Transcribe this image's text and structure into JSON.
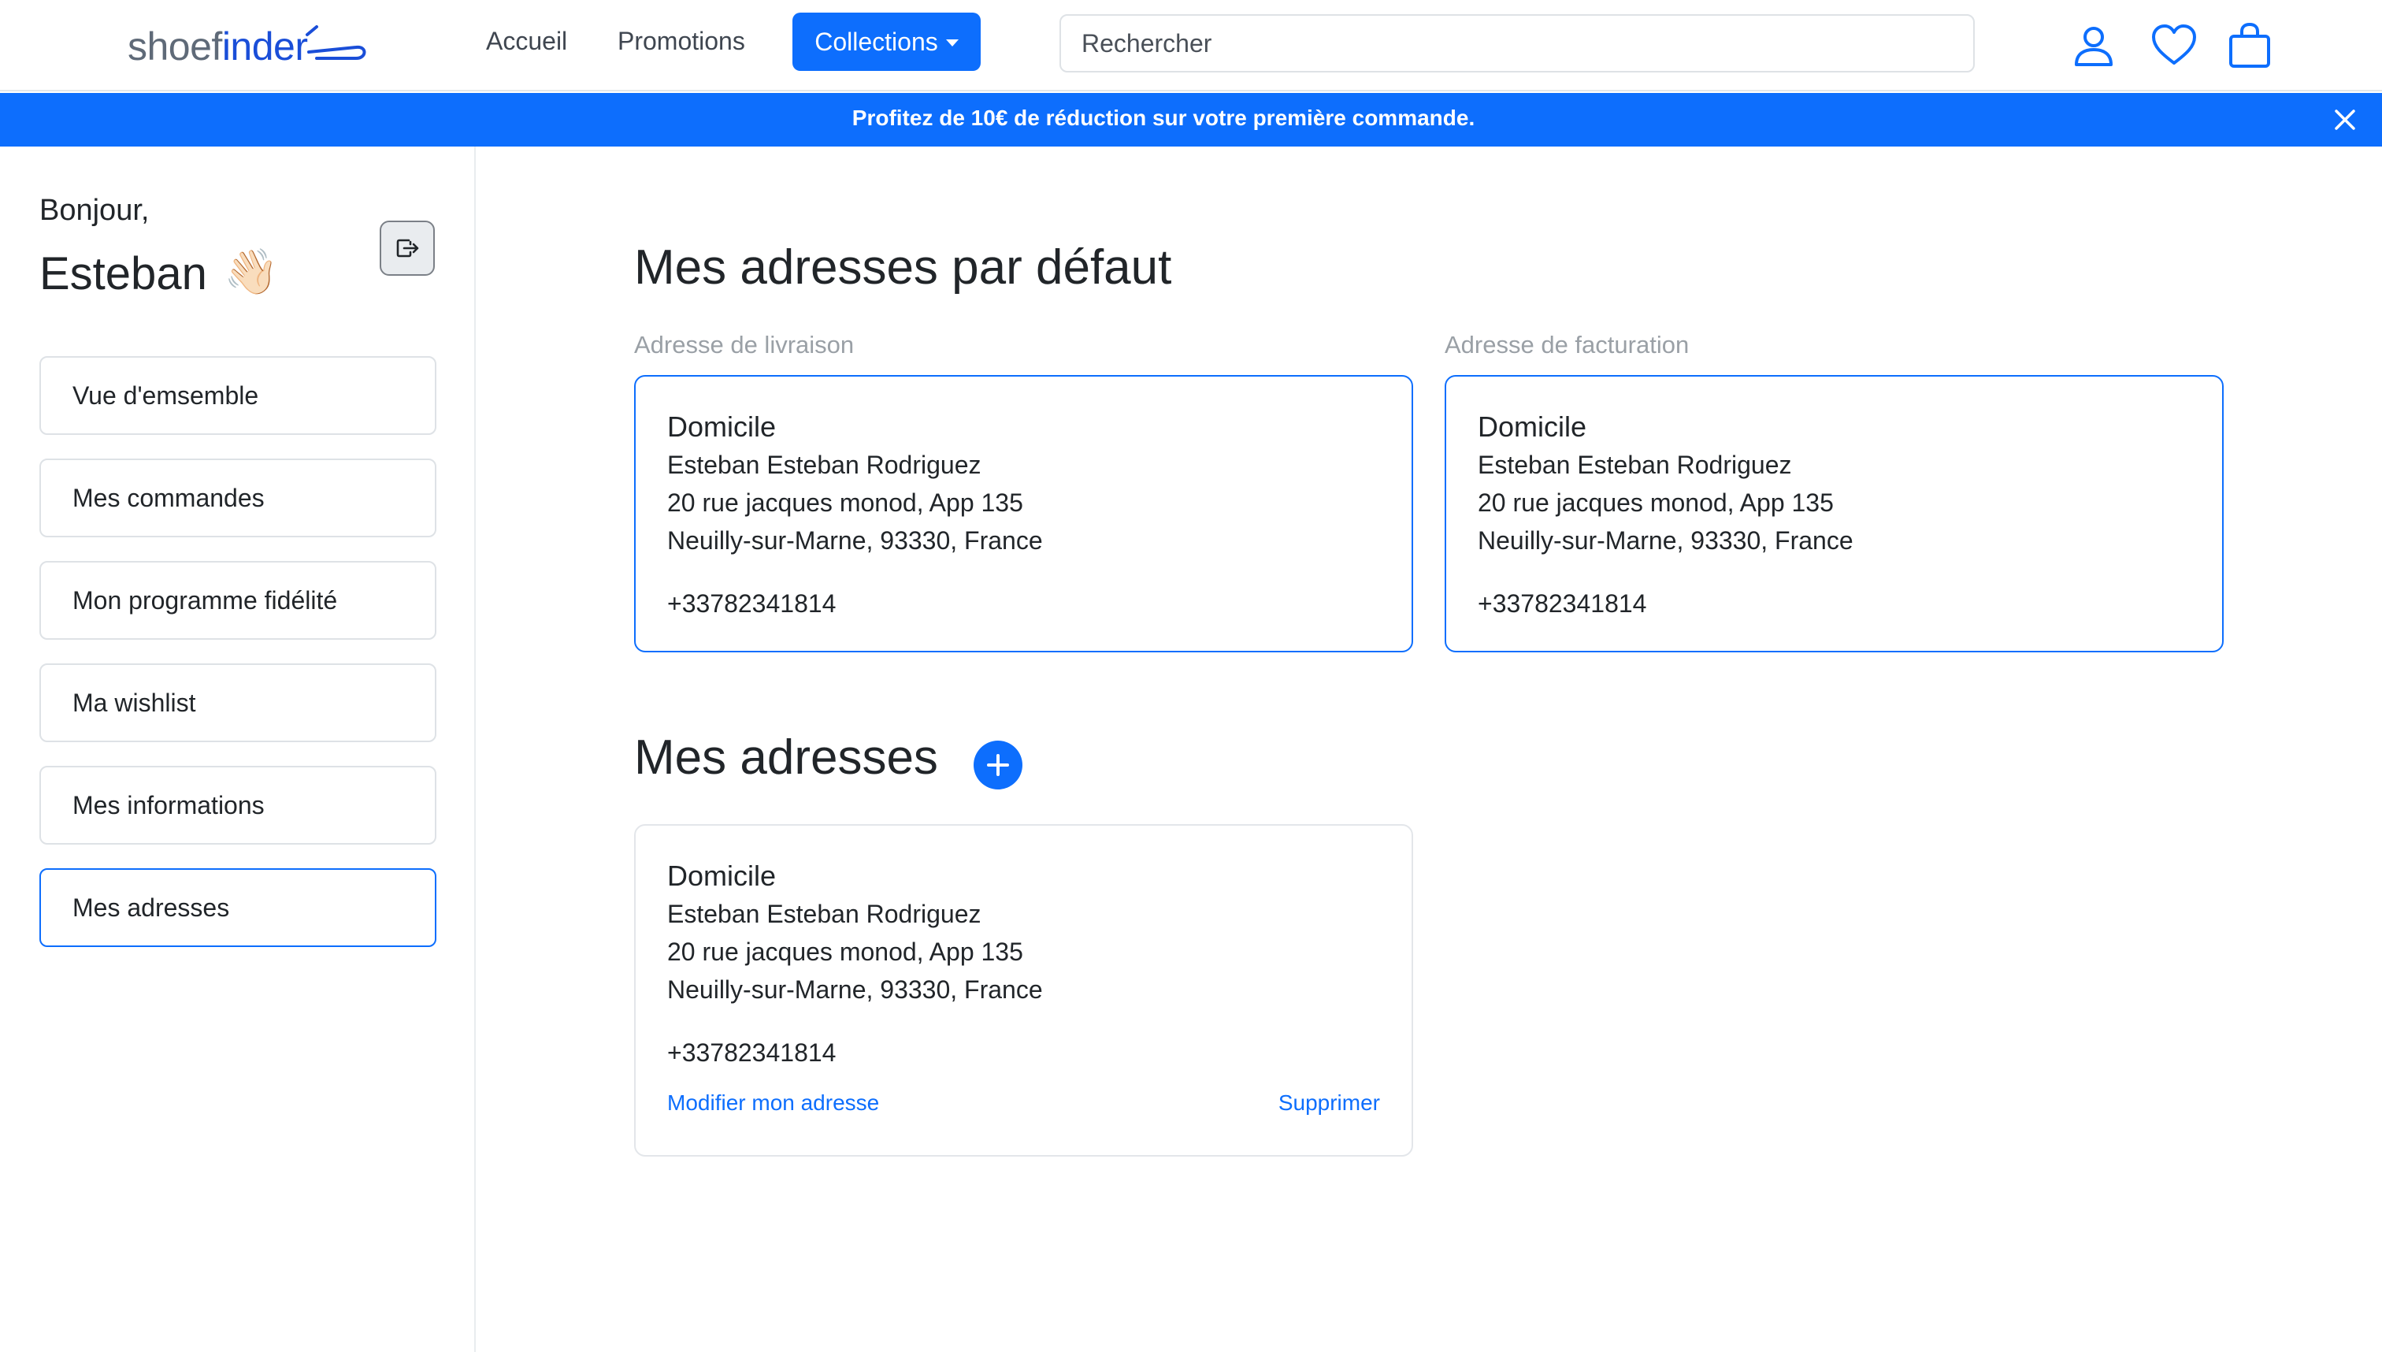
{
  "brand": {
    "logo_prefix": "shoef",
    "logo_suffix": "inder",
    "primary_color": "#0d6efd"
  },
  "nav": {
    "links": [
      {
        "label": "Accueil"
      },
      {
        "label": "Promotions"
      }
    ],
    "collections_label": "Collections",
    "search_placeholder": "Rechercher",
    "icons": [
      "user-icon",
      "heart-icon",
      "shopping-bag-icon"
    ]
  },
  "promo": {
    "text": "Profitez de 10€ de réduction sur votre première commande."
  },
  "sidebar": {
    "greeting": "Bonjour,",
    "username": "Esteban",
    "wave_emoji": "👋🏻",
    "menu": [
      {
        "label": "Vue d'emsemble"
      },
      {
        "label": "Mes commandes"
      },
      {
        "label": "Mon programme fidélité"
      },
      {
        "label": "Ma wishlist"
      },
      {
        "label": "Mes informations"
      },
      {
        "label": "Mes adresses",
        "active": true
      }
    ]
  },
  "main": {
    "default_title": "Mes adresses par défaut",
    "shipping_label": "Adresse de livraison",
    "billing_label": "Adresse de facturation",
    "shipping": {
      "name": "Domicile",
      "person": "Esteban Esteban Rodriguez",
      "street": "20 rue jacques monod, App 135",
      "city": "Neuilly-sur-Marne, 93330, France",
      "phone": "+33782341814"
    },
    "billing": {
      "name": "Domicile",
      "person": "Esteban Esteban Rodriguez",
      "street": "20 rue jacques monod, App 135",
      "city": "Neuilly-sur-Marne, 93330, France",
      "phone": "+33782341814"
    },
    "addresses_title": "Mes adresses",
    "addresses": [
      {
        "name": "Domicile",
        "person": "Esteban Esteban Rodriguez",
        "street": "20 rue jacques monod, App 135",
        "city": "Neuilly-sur-Marne, 93330, France",
        "phone": "+33782341814",
        "edit_label": "Modifier mon adresse",
        "delete_label": "Supprimer"
      }
    ]
  }
}
